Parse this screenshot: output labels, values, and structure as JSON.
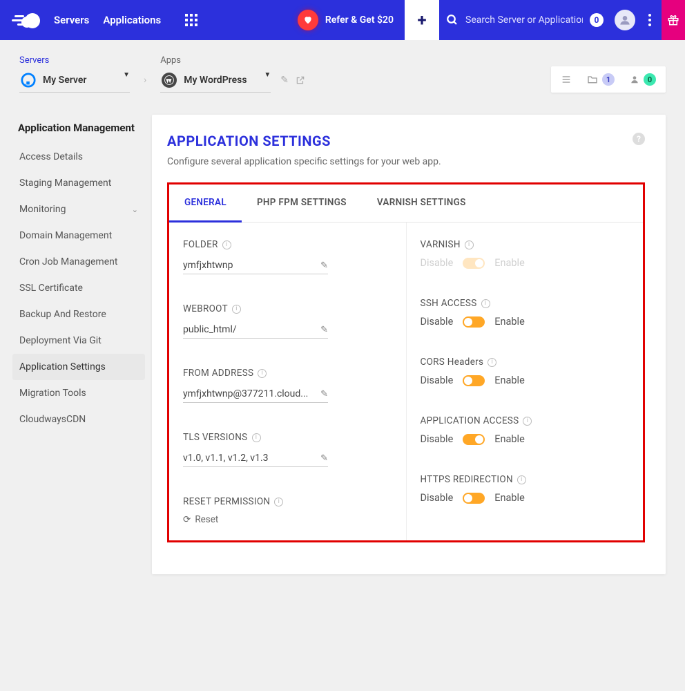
{
  "header": {
    "nav": {
      "servers": "Servers",
      "applications": "Applications"
    },
    "refer_label": "Refer & Get $20",
    "search_placeholder": "Search Server or Application",
    "search_count": "0"
  },
  "crumbs": {
    "servers_label": "Servers",
    "server_name": "My Server",
    "apps_label": "Apps",
    "app_name": "My WordPress"
  },
  "widgets": {
    "folder_count": "1",
    "user_count": "0"
  },
  "sidebar": {
    "title": "Application Management",
    "items": [
      "Access Details",
      "Staging Management",
      "Monitoring",
      "Domain Management",
      "Cron Job Management",
      "SSL Certificate",
      "Backup And Restore",
      "Deployment Via Git",
      "Application Settings",
      "Migration Tools",
      "CloudwaysCDN"
    ]
  },
  "panel": {
    "title": "APPLICATION SETTINGS",
    "subtitle": "Configure several application specific settings for your web app."
  },
  "tabs": {
    "general": "GENERAL",
    "php": "PHP FPM SETTINGS",
    "varnish": "VARNISH SETTINGS"
  },
  "settings": {
    "folder": {
      "label": "FOLDER",
      "value": "ymfjxhtwnp"
    },
    "webroot": {
      "label": "WEBROOT",
      "value": "public_html/"
    },
    "from": {
      "label": "FROM ADDRESS",
      "value": "ymfjxhtwnp@377211.cloud..."
    },
    "tls": {
      "label": "TLS VERSIONS",
      "value": "v1.0, v1.1, v1.2, v1.3"
    },
    "reset": {
      "label": "RESET PERMISSION",
      "action": "Reset"
    },
    "varnish": {
      "label": "VARNISH",
      "disable": "Disable",
      "enable": "Enable"
    },
    "ssh": {
      "label": "SSH ACCESS",
      "disable": "Disable",
      "enable": "Enable"
    },
    "cors": {
      "label": "CORS Headers",
      "disable": "Disable",
      "enable": "Enable"
    },
    "appaccess": {
      "label": "APPLICATION ACCESS",
      "disable": "Disable",
      "enable": "Enable"
    },
    "https": {
      "label": "HTTPS REDIRECTION",
      "disable": "Disable",
      "enable": "Enable"
    }
  }
}
